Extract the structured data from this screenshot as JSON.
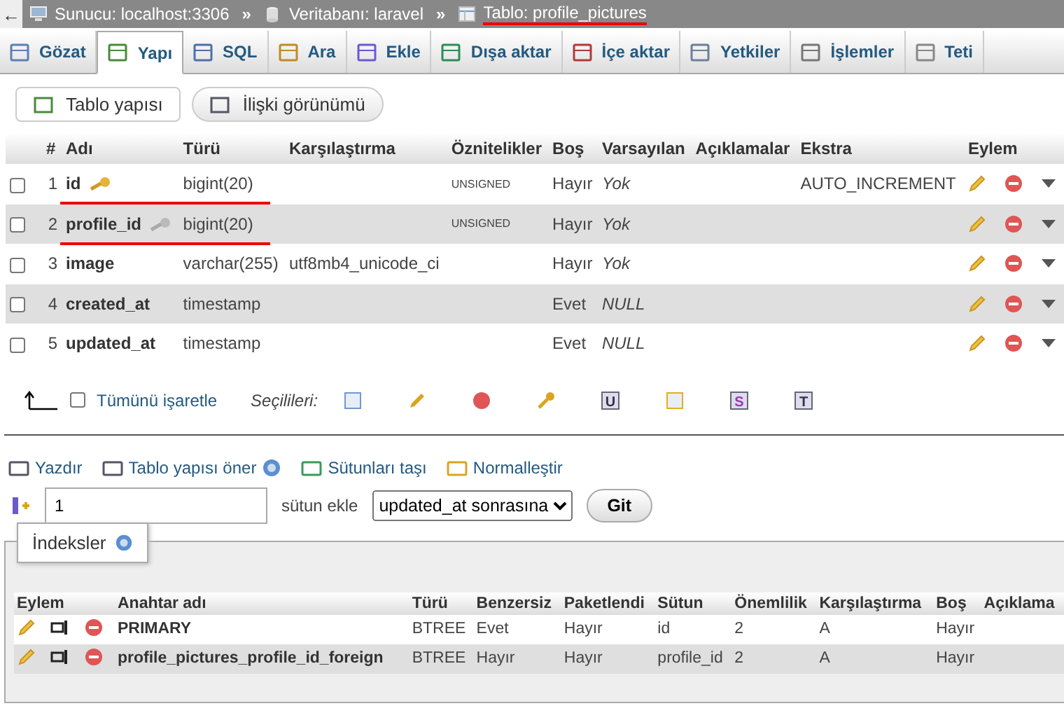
{
  "breadcrumb": [
    {
      "kind": "server",
      "text": "Sunucu: localhost:3306",
      "underlined": false
    },
    {
      "kind": "database",
      "text": "Veritabanı: laravel",
      "underlined": false
    },
    {
      "kind": "table",
      "text": "Tablo: profile_pictures",
      "underlined": true
    }
  ],
  "breadcrumb_separator": "»",
  "back_arrow": "←",
  "tabs": [
    {
      "kind": "browse",
      "label": "Gözat",
      "selected": false
    },
    {
      "kind": "structure",
      "label": "Yapı",
      "selected": true
    },
    {
      "kind": "sql",
      "label": "SQL",
      "selected": false
    },
    {
      "kind": "search",
      "label": "Ara",
      "selected": false
    },
    {
      "kind": "insert",
      "label": "Ekle",
      "selected": false
    },
    {
      "kind": "export",
      "label": "Dışa aktar",
      "selected": false
    },
    {
      "kind": "import",
      "label": "İçe aktar",
      "selected": false
    },
    {
      "kind": "privileges",
      "label": "Yetkiler",
      "selected": false
    },
    {
      "kind": "operations",
      "label": "İşlemler",
      "selected": false
    },
    {
      "kind": "triggers",
      "label": "Teti",
      "selected": false
    }
  ],
  "subtabs": [
    {
      "kind": "structure",
      "label": "Tablo yapısı",
      "selected": true
    },
    {
      "kind": "relation",
      "label": "İlişki görünümü",
      "selected": false
    }
  ],
  "columns_table": {
    "headers": [
      "#",
      "Adı",
      "Türü",
      "Karşılaştırma",
      "Öznitelikler",
      "Boş",
      "Varsayılan",
      "Açıklamalar",
      "Ekstra",
      "Eylem"
    ],
    "rows": [
      {
        "num": "1",
        "name": "id",
        "kind": "primary_key",
        "type": "bigint(20)",
        "collation": "",
        "attributes": "UNSIGNED",
        "null": "Hayır",
        "default": "Yok",
        "comments": "",
        "extra": "AUTO_INCREMENT",
        "underlined": true,
        "checked": false
      },
      {
        "num": "2",
        "name": "profile_id",
        "kind": "index_key",
        "type": "bigint(20)",
        "collation": "",
        "attributes": "UNSIGNED",
        "null": "Hayır",
        "default": "Yok",
        "comments": "",
        "extra": "",
        "underlined": true,
        "checked": false
      },
      {
        "num": "3",
        "name": "image",
        "kind": "plain",
        "type": "varchar(255)",
        "collation": "utf8mb4_unicode_ci",
        "attributes": "",
        "null": "Hayır",
        "default": "Yok",
        "comments": "",
        "extra": "",
        "underlined": false,
        "checked": false
      },
      {
        "num": "4",
        "name": "created_at",
        "kind": "plain",
        "type": "timestamp",
        "collation": "",
        "attributes": "",
        "null": "Evet",
        "default": "NULL",
        "comments": "",
        "extra": "",
        "underlined": false,
        "checked": false
      },
      {
        "num": "5",
        "name": "updated_at",
        "kind": "plain",
        "type": "timestamp",
        "collation": "",
        "attributes": "",
        "null": "Evet",
        "default": "NULL",
        "comments": "",
        "extra": "",
        "underlined": false,
        "checked": false
      }
    ]
  },
  "check_all": {
    "label": "Tümünü işaretle",
    "checked": false
  },
  "with_selected": {
    "label": "Seçilileri:",
    "actions": [
      {
        "kind": "browse"
      },
      {
        "kind": "edit"
      },
      {
        "kind": "drop"
      },
      {
        "kind": "primary"
      },
      {
        "kind": "unique",
        "letter": "U"
      },
      {
        "kind": "index"
      },
      {
        "kind": "spatial",
        "letter": "S"
      },
      {
        "kind": "fulltext",
        "letter": "T"
      }
    ]
  },
  "links": [
    {
      "kind": "print",
      "label": "Yazdır"
    },
    {
      "kind": "propose",
      "label": "Tablo yapısı öner"
    },
    {
      "kind": "move",
      "label": "Sütunları taşı"
    },
    {
      "kind": "normalize",
      "label": "Normalleştir"
    }
  ],
  "add_column": {
    "value": "1",
    "label": "sütun ekle",
    "position": "updated_at sonrasına",
    "button": "Git"
  },
  "indexes": {
    "legend": "İndeksler",
    "headers": [
      "Eylem",
      "Anahtar adı",
      "Türü",
      "Benzersiz",
      "Paketlendi",
      "Sütun",
      "Önemlilik",
      "Karşılaştırma",
      "Boş",
      "Açıklama"
    ],
    "rows": [
      {
        "name": "PRIMARY",
        "type": "BTREE",
        "unique": "Evet",
        "packed": "Hayır",
        "column": "id",
        "cardinality": "2",
        "collation": "A",
        "null": "Hayır",
        "comment": ""
      },
      {
        "name": "profile_pictures_profile_id_foreign",
        "type": "BTREE",
        "unique": "Hayır",
        "packed": "Hayır",
        "column": "profile_id",
        "cardinality": "2",
        "collation": "A",
        "null": "Hayır",
        "comment": ""
      }
    ]
  }
}
